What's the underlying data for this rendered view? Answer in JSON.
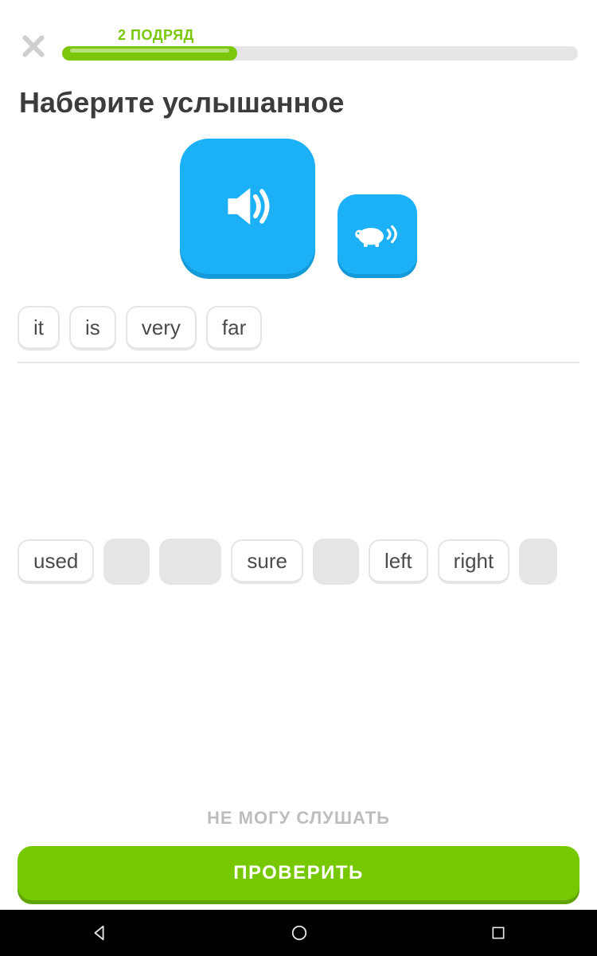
{
  "header": {
    "streak_label": "2 ПОДРЯД",
    "progress_percent": 34
  },
  "prompt": "Наберите услышанное",
  "answer_chips": [
    "it",
    "is",
    "very",
    "far"
  ],
  "bank": [
    {
      "type": "chip",
      "label": "used"
    },
    {
      "type": "slot",
      "size": "w1"
    },
    {
      "type": "slot",
      "size": "w2"
    },
    {
      "type": "chip",
      "label": "sure"
    },
    {
      "type": "slot",
      "size": "w1"
    },
    {
      "type": "chip",
      "label": "left"
    },
    {
      "type": "chip",
      "label": "right"
    },
    {
      "type": "slot",
      "size": "w0"
    }
  ],
  "footer": {
    "skip_label": "НЕ МОГУ СЛУШАТЬ",
    "check_label": "ПРОВЕРИТЬ"
  }
}
